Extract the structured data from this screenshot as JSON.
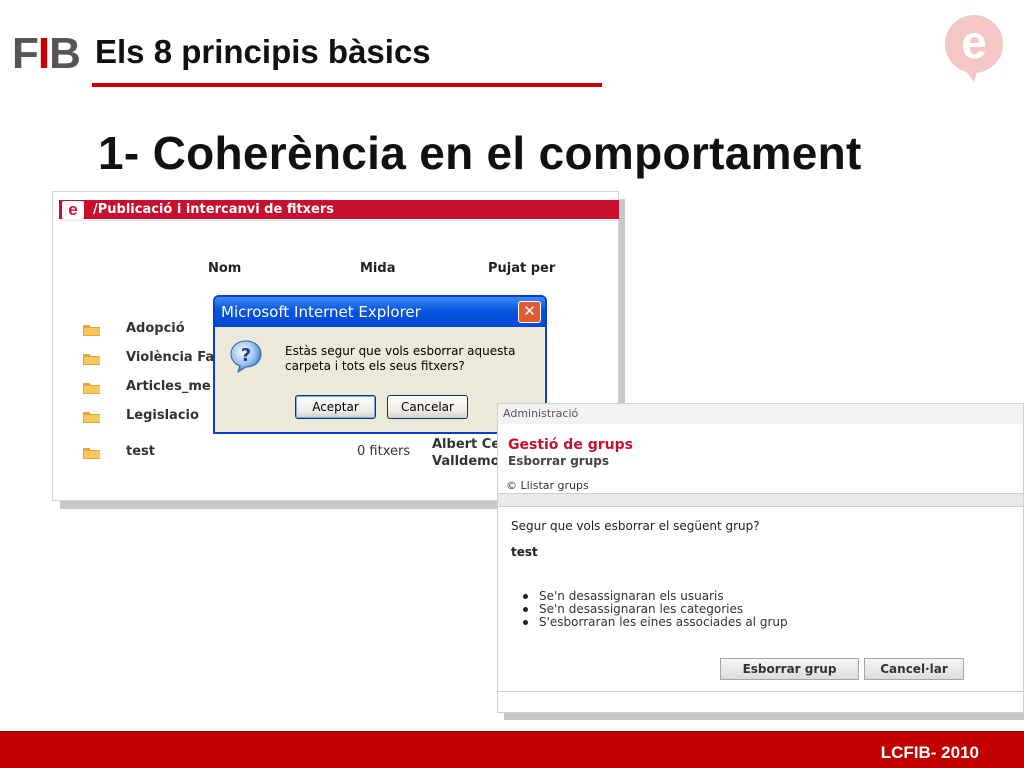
{
  "slide": {
    "logo_text": [
      "F",
      "I",
      "B"
    ],
    "subtitle": "Els 8 principis bàsics",
    "title": "1- Coherència en el comportament",
    "e_logo_letter": "e",
    "footer": "LCFIB- 2010",
    "colors": {
      "accent": "#cc0000",
      "footer_bg": "#c00000"
    }
  },
  "screenshot1": {
    "logo_letter": "e",
    "bar_title": "/Publicació i intercanvi de fitxers",
    "columns": {
      "name": "Nom",
      "size": "Mida",
      "uploaded_by": "Pujat per"
    },
    "rows": [
      {
        "name": "Adopció",
        "size": "",
        "owner1": "",
        "owner2": ""
      },
      {
        "name": "Violència Fa",
        "size": "",
        "owner1": "",
        "owner2": ""
      },
      {
        "name": "Articles_me",
        "size": "",
        "owner1": "",
        "owner2": ""
      },
      {
        "name": "Legislacio",
        "size": "",
        "owner1": "",
        "owner2": ""
      },
      {
        "name": "test",
        "size": "0 fitxers",
        "owner1": "Albert Ce",
        "owner2": "Valldemo"
      }
    ],
    "icons": {
      "folder": "folder-icon"
    }
  },
  "dialog": {
    "title": "Microsoft Internet Explorer",
    "close_glyph": "✕",
    "message": "Estàs segur que vols esborrar aquesta carpeta i tots els seus fitxers?",
    "ok_label": "Aceptar",
    "cancel_label": "Cancelar",
    "icons": {
      "question": "question-icon",
      "close": "close-icon"
    }
  },
  "screenshot2": {
    "admin_label": "Administració",
    "heading": "Gestió de grups",
    "subheading": "Esborrar grups",
    "link_icon": "©",
    "link": "Llistar grups",
    "question": "Segur que vols esborrar el següent grup?",
    "group_name": "test",
    "consequences": [
      "Se'n desassignaran els usuaris",
      "Se'n desassignaran les categories",
      "S'esborraran les eines associades al grup"
    ],
    "delete_label": "Esborrar grup",
    "cancel_label": "Cancel·lar"
  }
}
